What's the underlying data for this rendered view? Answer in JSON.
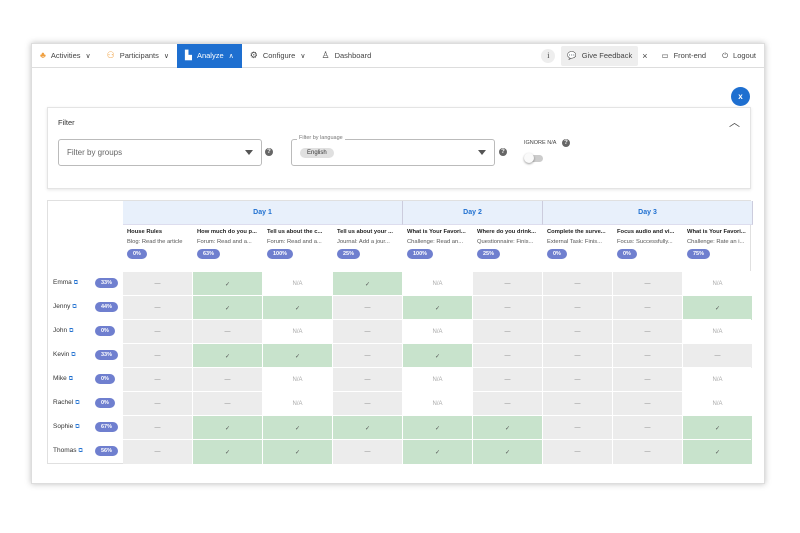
{
  "nav": {
    "items": [
      {
        "label": "Activities",
        "icon": "activities-icon"
      },
      {
        "label": "Participants",
        "icon": "participants-icon"
      },
      {
        "label": "Analyze",
        "icon": "chart-icon",
        "active": true
      },
      {
        "label": "Configure",
        "icon": "gears-icon"
      },
      {
        "label": "Dashboard",
        "icon": "dashboard-icon"
      }
    ],
    "info": "i",
    "feedback": "Give Feedback",
    "frontend": "Front-end",
    "logout": "Logout"
  },
  "export_icon": "excel-export-icon",
  "filter": {
    "title": "Filter",
    "groups_placeholder": "Filter by groups",
    "language_label": "Filter by language",
    "language_value": "English",
    "ignore_na": "IGNORE N/A",
    "ignore_na_on": false
  },
  "days": [
    {
      "label": "Day 1",
      "span": 4
    },
    {
      "label": "Day 2",
      "span": 2
    },
    {
      "label": "Day 3",
      "span": 3
    }
  ],
  "activities": [
    {
      "title": "House Rules",
      "sub": "Blog: Read the article",
      "pct": "0%"
    },
    {
      "title": "How much do you p...",
      "sub": "Forum: Read and a...",
      "pct": "63%"
    },
    {
      "title": "Tell us about the c...",
      "sub": "Forum: Read and a...",
      "pct": "100%"
    },
    {
      "title": "Tell us about your ...",
      "sub": "Journal: Add a jour...",
      "pct": "25%"
    },
    {
      "title": "What is Your Favori...",
      "sub": "Challenge: Read an...",
      "pct": "100%"
    },
    {
      "title": "Where do you drink...",
      "sub": "Questionnaire: Finis...",
      "pct": "25%"
    },
    {
      "title": "Complete the surve...",
      "sub": "External Task: Finis...",
      "pct": "0%"
    },
    {
      "title": "Focus audio and vi...",
      "sub": "Focus: Successfully...",
      "pct": "0%"
    },
    {
      "title": "What is Your Favori...",
      "sub": "Challenge: Rate an i...",
      "pct": "75%"
    }
  ],
  "cell_text": {
    "g": "✓",
    "d": "—",
    "n": "N/A"
  },
  "participants": [
    {
      "name": "Emma",
      "pct": "33%",
      "cells": "dgngndddn"
    },
    {
      "name": "Jenny",
      "pct": "44%",
      "cells": "dggdgdddg"
    },
    {
      "name": "John",
      "pct": "0%",
      "cells": "ddndndddn"
    },
    {
      "name": "Kevin",
      "pct": "33%",
      "cells": "dggdgdddd"
    },
    {
      "name": "Mike",
      "pct": "0%",
      "cells": "ddndndddn"
    },
    {
      "name": "Rachel",
      "pct": "0%",
      "cells": "ddndndddn"
    },
    {
      "name": "Sophie",
      "pct": "67%",
      "cells": "dgggggddg"
    },
    {
      "name": "Thomas",
      "pct": "56%",
      "cells": "dggdggddg"
    }
  ],
  "colors": {
    "accent": "#1e6fd0",
    "complete": "#c8e3cc",
    "pending": "#ececec",
    "pill": "#6f7fcf"
  }
}
